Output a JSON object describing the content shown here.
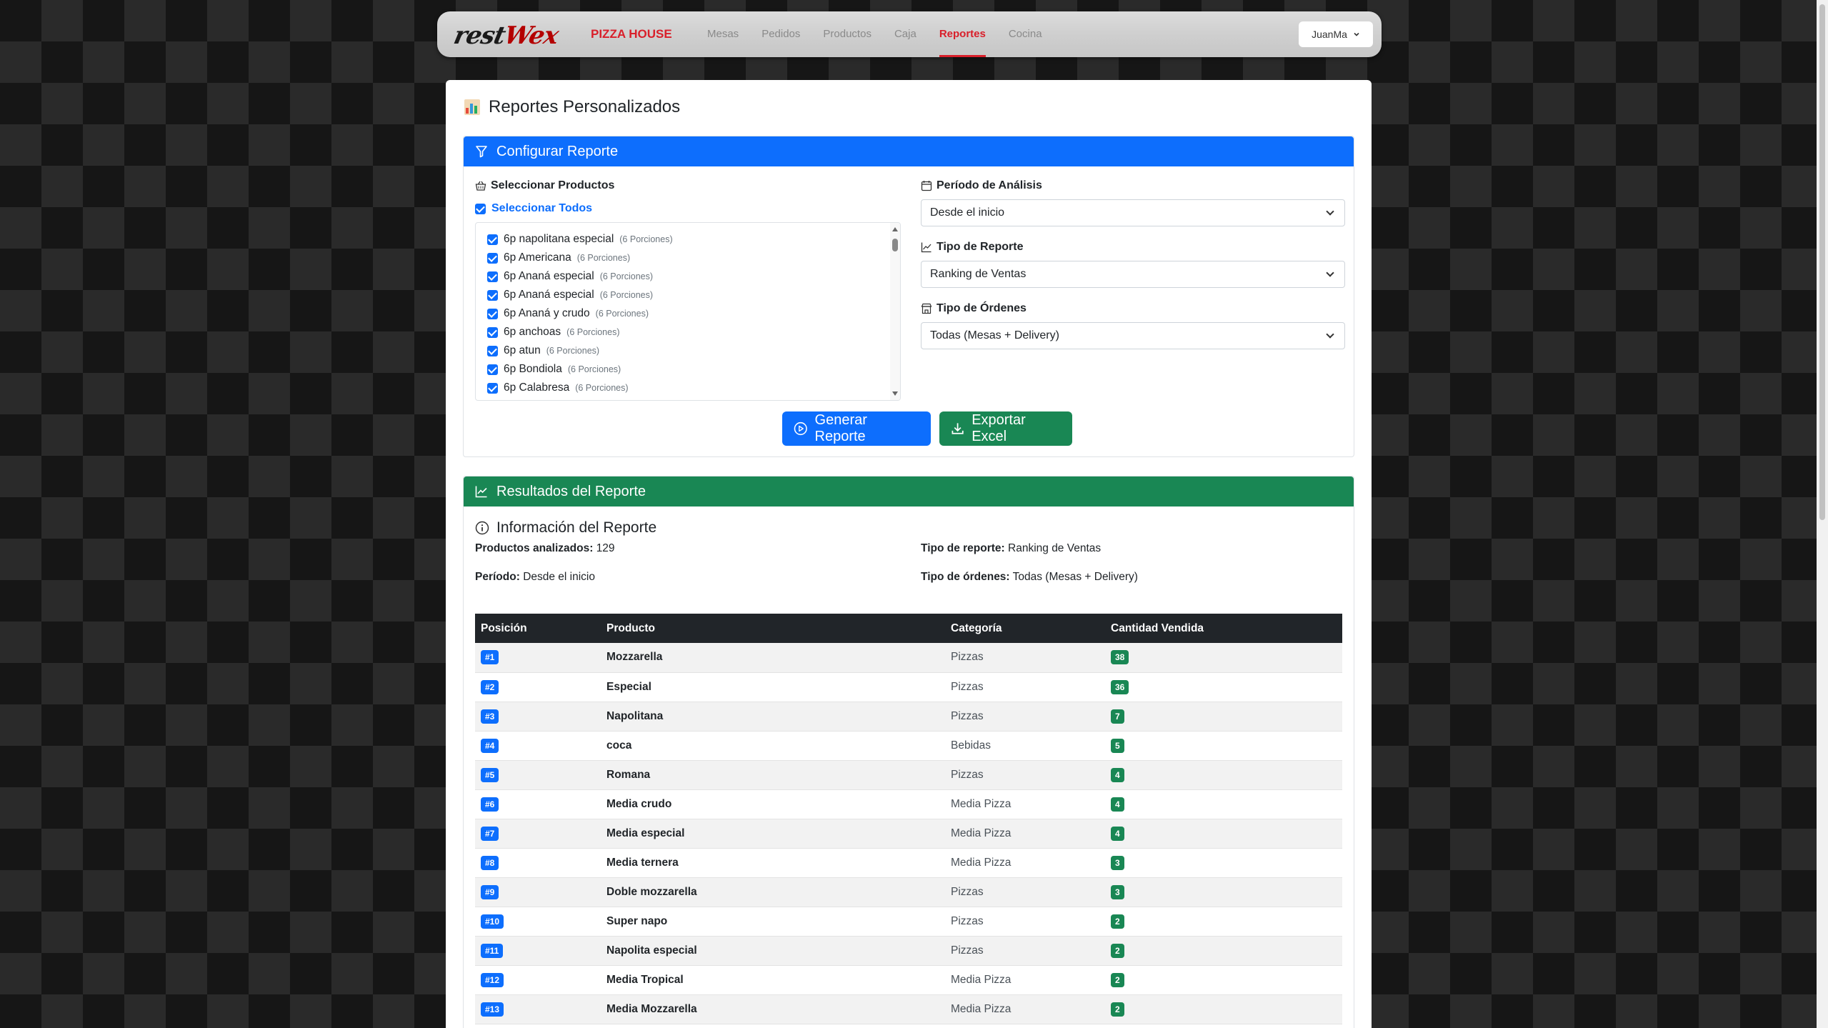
{
  "nav": {
    "logo": {
      "part1": "rest",
      "part2": "Wex"
    },
    "brand": "PIZZA HOUSE",
    "links": [
      "Mesas",
      "Pedidos",
      "Productos",
      "Caja",
      "Reportes",
      "Cocina"
    ],
    "active_link": "Reportes",
    "user": "JuanMa"
  },
  "page_title": "Reportes Personalizados",
  "config": {
    "header": "Configurar Reporte",
    "products_label": "Seleccionar Productos",
    "select_all": "Seleccionar Todos",
    "products": [
      {
        "name": "6p napolitana especial",
        "portions": "(6 Porciones)"
      },
      {
        "name": "6p Americana",
        "portions": "(6 Porciones)"
      },
      {
        "name": "6p Ananá especial",
        "portions": "(6 Porciones)"
      },
      {
        "name": "6p Ananá especial",
        "portions": "(6 Porciones)"
      },
      {
        "name": "6p Ananá y crudo",
        "portions": "(6 Porciones)"
      },
      {
        "name": "6p anchoas",
        "portions": "(6 Porciones)"
      },
      {
        "name": "6p atun",
        "portions": "(6 Porciones)"
      },
      {
        "name": "6p Bondiola",
        "portions": "(6 Porciones)"
      },
      {
        "name": "6p Calabresa",
        "portions": "(6 Porciones)"
      }
    ],
    "period_label": "Período de Análisis",
    "period_value": "Desde el inicio",
    "type_label": "Tipo de Reporte",
    "type_value": "Ranking de Ventas",
    "orders_label": "Tipo de Órdenes",
    "orders_value": "Todas (Mesas + Delivery)",
    "generate_button": "Generar Reporte",
    "export_button": "Exportar Excel"
  },
  "results": {
    "header": "Resultados del Reporte",
    "info_title": "Información del Reporte",
    "analyzed_label": "Productos analizados:",
    "analyzed_value": "129",
    "period_label": "Período:",
    "period_value": "Desde el inicio",
    "type_label": "Tipo de reporte:",
    "type_value": "Ranking de Ventas",
    "orders_label": "Tipo de órdenes:",
    "orders_value": "Todas (Mesas + Delivery)",
    "columns": [
      "Posición",
      "Producto",
      "Categoría",
      "Cantidad Vendida"
    ],
    "rows": [
      {
        "pos": "#1",
        "product": "Mozzarella",
        "category": "Pizzas",
        "qty": "38"
      },
      {
        "pos": "#2",
        "product": "Especial",
        "category": "Pizzas",
        "qty": "36"
      },
      {
        "pos": "#3",
        "product": "Napolitana",
        "category": "Pizzas",
        "qty": "7"
      },
      {
        "pos": "#4",
        "product": "coca",
        "category": "Bebidas",
        "qty": "5"
      },
      {
        "pos": "#5",
        "product": "Romana",
        "category": "Pizzas",
        "qty": "4"
      },
      {
        "pos": "#6",
        "product": "Media crudo",
        "category": "Media Pizza",
        "qty": "4"
      },
      {
        "pos": "#7",
        "product": "Media especial",
        "category": "Media Pizza",
        "qty": "4"
      },
      {
        "pos": "#8",
        "product": "Media ternera",
        "category": "Media Pizza",
        "qty": "3"
      },
      {
        "pos": "#9",
        "product": "Doble mozzarella",
        "category": "Pizzas",
        "qty": "3"
      },
      {
        "pos": "#10",
        "product": "Super napo",
        "category": "Pizzas",
        "qty": "2"
      },
      {
        "pos": "#11",
        "product": "Napolita especial",
        "category": "Pizzas",
        "qty": "2"
      },
      {
        "pos": "#12",
        "product": "Media Tropical",
        "category": "Media Pizza",
        "qty": "2"
      },
      {
        "pos": "#13",
        "product": "Media Mozzarella",
        "category": "Media Pizza",
        "qty": "2"
      }
    ]
  },
  "colors": {
    "primary": "#0d6efd",
    "success": "#198754",
    "brand_red": "#d91f2a",
    "dark": "#212529"
  }
}
